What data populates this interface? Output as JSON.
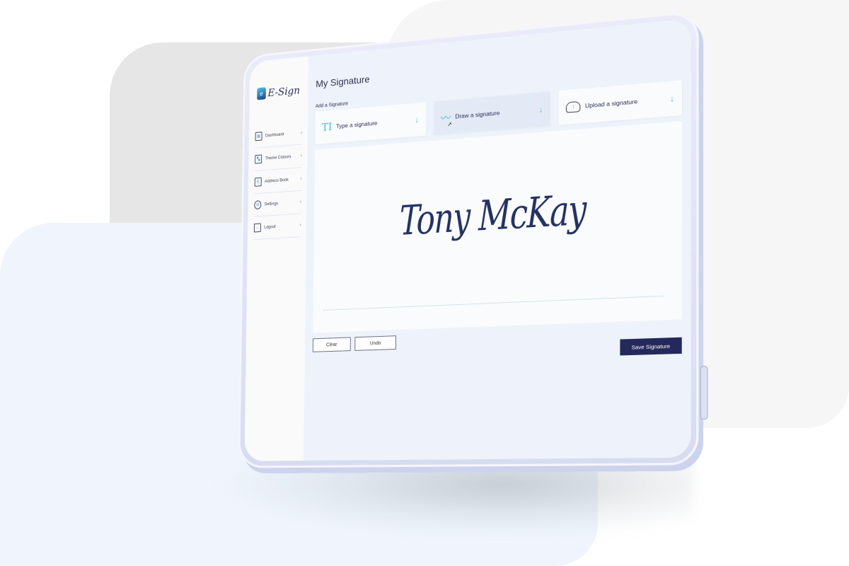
{
  "app": {
    "logo_mark": "e",
    "logo_text": "E-Sign"
  },
  "sidebar": {
    "items": [
      {
        "label": "Dashboard",
        "icon": "dashboard-icon",
        "chevron": "›"
      },
      {
        "label": "Theme Colours",
        "icon": "palette-icon",
        "chevron": "›"
      },
      {
        "label": "Address Book",
        "icon": "address-book-icon",
        "chevron": "›"
      },
      {
        "label": "Settings",
        "icon": "gear-icon",
        "chevron": "›"
      },
      {
        "label": "Logout",
        "icon": "logout-icon",
        "chevron": "›"
      }
    ]
  },
  "main": {
    "title": "My Signature",
    "section_label": "Add a Signature",
    "options": [
      {
        "label": "Type a signature",
        "icon": "text-cursor-icon",
        "glyph": "TI",
        "arrow": "↓",
        "active": false
      },
      {
        "label": "Draw a signature",
        "icon": "pen-scribble-icon",
        "glyph": "〰",
        "arrow": "↓",
        "active": true
      },
      {
        "label": "Upload a signature",
        "icon": "cloud-upload-icon",
        "glyph": "↑",
        "arrow": "↓",
        "active": false
      }
    ],
    "signature_text": "Tony McKay",
    "buttons": {
      "clear": "Clear",
      "undo": "Undo",
      "save": "Save Signature"
    }
  },
  "colors": {
    "accent": "#4bb8d9",
    "primary": "#24295b",
    "signature_ink": "#243262"
  }
}
